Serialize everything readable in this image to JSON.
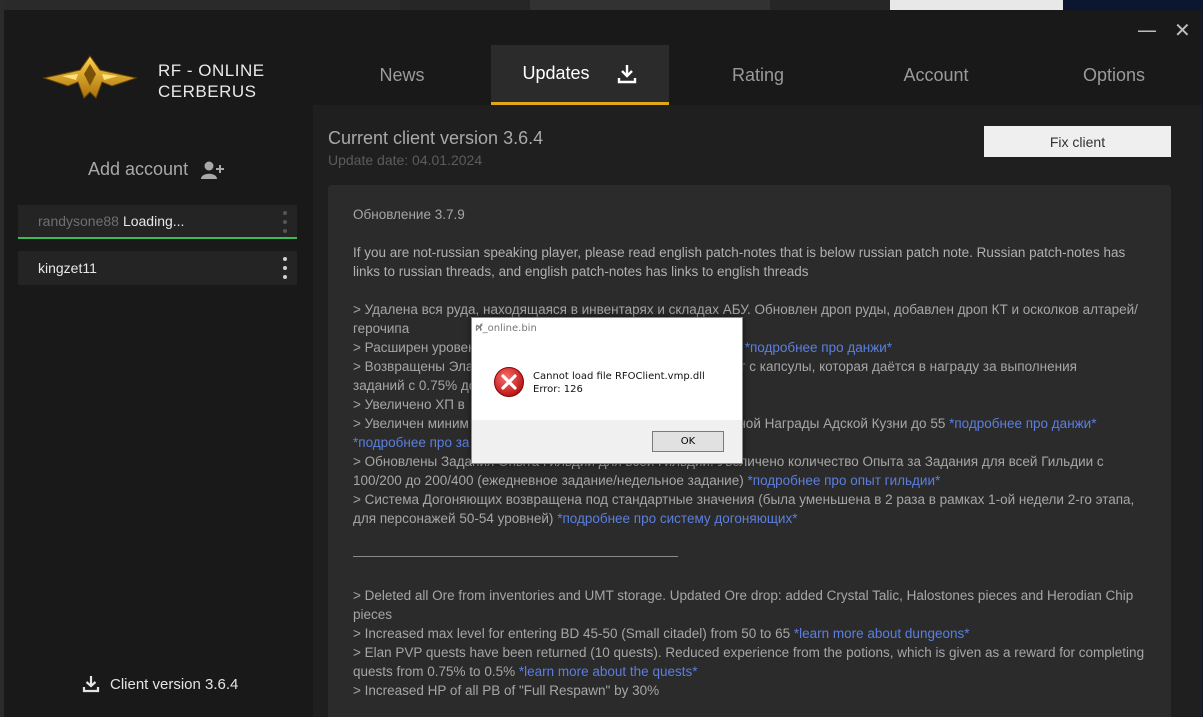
{
  "window": {
    "minimize": "—",
    "close": "✕"
  },
  "brand": {
    "line1": "RF - ONLINE",
    "line2": "CERBERUS"
  },
  "tabs": [
    {
      "label": "News"
    },
    {
      "label": "Updates",
      "active": true
    },
    {
      "label": "Rating"
    },
    {
      "label": "Account"
    },
    {
      "label": "Options"
    }
  ],
  "sidebar": {
    "add_account": "Add account",
    "accounts": [
      {
        "name": "randysone88",
        "status": "Loading..."
      },
      {
        "name": "kingzet11"
      }
    ],
    "client_version": "Client version 3.6.4"
  },
  "main": {
    "current_version": "Current client version 3.6.4",
    "update_date": "Update date: 04.01.2024",
    "fix_button": "Fix client",
    "notes": {
      "title": "Обновление 3.7.9",
      "intro": "If you are not-russian speaking player, please read english patch-notes that is below russian patch note. Russian patch-notes has links to russian threads, and english patch-notes has links to english threads",
      "ru1": "> Удалена вся руда, находящаяся в инвентарях и складах АБУ. Обновлен дроп руды, добавлен дроп КТ и осколков алтарей/герочипа",
      "ru2a": "> Расширен уровень",
      "ru2b": "*подробнее про данжи*",
      "ru3": "> Возвращены Элан",
      "ru3b": "опыт с капсулы, которая даётся в награду за выполнения",
      "ru4": "заданий с 0.75% до",
      "ru5": "> Увеличено ХП в",
      "ru6a": "> Увеличен миним",
      "ru6b": "йной Награды Адской Кузни до 55",
      "ru6c": "*подробнее про данжи*",
      "ru7": "*подробнее про за",
      "ru8": "> Обновлены Задания Опыта Гильдии для всей Гильдии. Увеличено количество Опыта за Задания для всей Гильдии с 100/200 до 200/400 (ежедневное задание/недельное задание)",
      "ru8link": "*подробнее про опыт гильдии*",
      "ru9": "> Система Догоняющих возвращена под стандартные значения (была уменьшена в 2 раза в рамках 1-ой недели 2-го этапа, для персонажей 50-54 уровней)",
      "ru9link": "*подробнее про систему догоняющих*",
      "en1": "> Deleted all Ore from inventories and UMT storage. Updated Ore drop: added Crystal Talic, Halostones pieces and Herodian Chip pieces",
      "en2": "> Increased max level for entering BD 45-50 (Small citadel) from 50 to 65",
      "en2link": "*learn more about dungeons*",
      "en3": "> Elan PVP quests have been returned (10 quests). Reduced experience from the potions, which is given as a reward for completing quests from 0.75% to 0.5%",
      "en3link": "*learn more about the quests*",
      "en4": "> Increased HP of all PB of \"Full Respawn\" by 30%"
    }
  },
  "dialog": {
    "title": "rf_online.bin",
    "message_line1": "Cannot load file RFOClient.vmp.dll",
    "message_line2": "Error: 126",
    "ok": "OK"
  },
  "colors": {
    "accent": "#e0a71a",
    "loading": "#3dbb58",
    "link": "#5b7fe0"
  }
}
